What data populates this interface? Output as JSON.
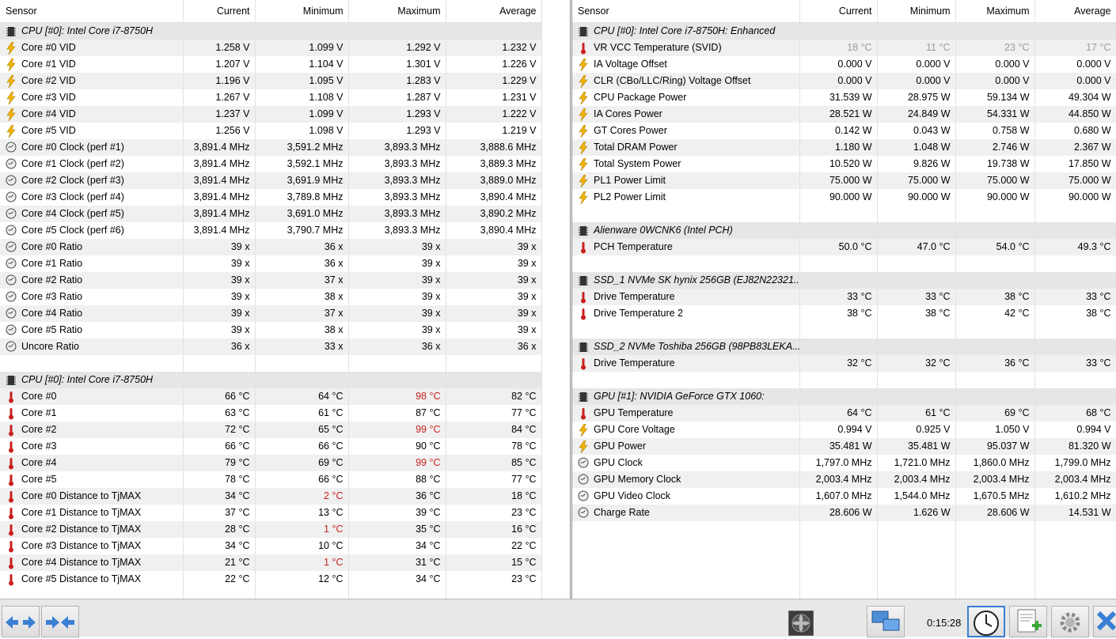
{
  "left": {
    "headers": [
      "Sensor",
      "Current",
      "Minimum",
      "Maximum",
      "Average"
    ],
    "rows": [
      {
        "type": "group",
        "icon": "chip",
        "name": "CPU [#0]: Intel Core i7-8750H"
      },
      {
        "icon": "bolt",
        "name": "Core #0 VID",
        "cur": "1.258 V",
        "min": "1.099 V",
        "max": "1.292 V",
        "avg": "1.232 V"
      },
      {
        "icon": "bolt",
        "name": "Core #1 VID",
        "cur": "1.207 V",
        "min": "1.104 V",
        "max": "1.301 V",
        "avg": "1.226 V"
      },
      {
        "icon": "bolt",
        "name": "Core #2 VID",
        "cur": "1.196 V",
        "min": "1.095 V",
        "max": "1.283 V",
        "avg": "1.229 V"
      },
      {
        "icon": "bolt",
        "name": "Core #3 VID",
        "cur": "1.267 V",
        "min": "1.108 V",
        "max": "1.287 V",
        "avg": "1.231 V"
      },
      {
        "icon": "bolt",
        "name": "Core #4 VID",
        "cur": "1.237 V",
        "min": "1.099 V",
        "max": "1.293 V",
        "avg": "1.222 V"
      },
      {
        "icon": "bolt",
        "name": "Core #5 VID",
        "cur": "1.256 V",
        "min": "1.098 V",
        "max": "1.293 V",
        "avg": "1.219 V"
      },
      {
        "icon": "clock",
        "name": "Core #0 Clock (perf #1)",
        "cur": "3,891.4 MHz",
        "min": "3,591.2 MHz",
        "max": "3,893.3 MHz",
        "avg": "3,888.6 MHz"
      },
      {
        "icon": "clock",
        "name": "Core #1 Clock (perf #2)",
        "cur": "3,891.4 MHz",
        "min": "3,592.1 MHz",
        "max": "3,893.3 MHz",
        "avg": "3,889.3 MHz"
      },
      {
        "icon": "clock",
        "name": "Core #2 Clock (perf #3)",
        "cur": "3,891.4 MHz",
        "min": "3,691.9 MHz",
        "max": "3,893.3 MHz",
        "avg": "3,889.0 MHz"
      },
      {
        "icon": "clock",
        "name": "Core #3 Clock (perf #4)",
        "cur": "3,891.4 MHz",
        "min": "3,789.8 MHz",
        "max": "3,893.3 MHz",
        "avg": "3,890.4 MHz"
      },
      {
        "icon": "clock",
        "name": "Core #4 Clock (perf #5)",
        "cur": "3,891.4 MHz",
        "min": "3,691.0 MHz",
        "max": "3,893.3 MHz",
        "avg": "3,890.2 MHz"
      },
      {
        "icon": "clock",
        "name": "Core #5 Clock (perf #6)",
        "cur": "3,891.4 MHz",
        "min": "3,790.7 MHz",
        "max": "3,893.3 MHz",
        "avg": "3,890.4 MHz"
      },
      {
        "icon": "clock",
        "name": "Core #0 Ratio",
        "cur": "39 x",
        "min": "36 x",
        "max": "39 x",
        "avg": "39 x"
      },
      {
        "icon": "clock",
        "name": "Core #1 Ratio",
        "cur": "39 x",
        "min": "36 x",
        "max": "39 x",
        "avg": "39 x"
      },
      {
        "icon": "clock",
        "name": "Core #2 Ratio",
        "cur": "39 x",
        "min": "37 x",
        "max": "39 x",
        "avg": "39 x"
      },
      {
        "icon": "clock",
        "name": "Core #3 Ratio",
        "cur": "39 x",
        "min": "38 x",
        "max": "39 x",
        "avg": "39 x"
      },
      {
        "icon": "clock",
        "name": "Core #4 Ratio",
        "cur": "39 x",
        "min": "37 x",
        "max": "39 x",
        "avg": "39 x"
      },
      {
        "icon": "clock",
        "name": "Core #5 Ratio",
        "cur": "39 x",
        "min": "38 x",
        "max": "39 x",
        "avg": "39 x"
      },
      {
        "icon": "clock",
        "name": "Uncore Ratio",
        "cur": "36 x",
        "min": "33 x",
        "max": "36 x",
        "avg": "36 x"
      },
      {
        "type": "blank"
      },
      {
        "type": "group",
        "icon": "chip",
        "name": "CPU [#0]: Intel Core i7-8750H"
      },
      {
        "icon": "therm",
        "name": "Core #0",
        "cur": "66 °C",
        "min": "64 °C",
        "max": "98 °C",
        "avg": "82 °C",
        "red": [
          "max"
        ]
      },
      {
        "icon": "therm",
        "name": "Core #1",
        "cur": "63 °C",
        "min": "61 °C",
        "max": "87 °C",
        "avg": "77 °C"
      },
      {
        "icon": "therm",
        "name": "Core #2",
        "cur": "72 °C",
        "min": "65 °C",
        "max": "99 °C",
        "avg": "84 °C",
        "red": [
          "max"
        ]
      },
      {
        "icon": "therm",
        "name": "Core #3",
        "cur": "66 °C",
        "min": "66 °C",
        "max": "90 °C",
        "avg": "78 °C"
      },
      {
        "icon": "therm",
        "name": "Core #4",
        "cur": "79 °C",
        "min": "69 °C",
        "max": "99 °C",
        "avg": "85 °C",
        "red": [
          "max"
        ]
      },
      {
        "icon": "therm",
        "name": "Core #5",
        "cur": "78 °C",
        "min": "66 °C",
        "max": "88 °C",
        "avg": "77 °C"
      },
      {
        "icon": "therm",
        "name": "Core #0 Distance to TjMAX",
        "cur": "34 °C",
        "min": "2 °C",
        "max": "36 °C",
        "avg": "18 °C",
        "red": [
          "min"
        ]
      },
      {
        "icon": "therm",
        "name": "Core #1 Distance to TjMAX",
        "cur": "37 °C",
        "min": "13 °C",
        "max": "39 °C",
        "avg": "23 °C"
      },
      {
        "icon": "therm",
        "name": "Core #2 Distance to TjMAX",
        "cur": "28 °C",
        "min": "1 °C",
        "max": "35 °C",
        "avg": "16 °C",
        "red": [
          "min"
        ]
      },
      {
        "icon": "therm",
        "name": "Core #3 Distance to TjMAX",
        "cur": "34 °C",
        "min": "10 °C",
        "max": "34 °C",
        "avg": "22 °C"
      },
      {
        "icon": "therm",
        "name": "Core #4 Distance to TjMAX",
        "cur": "21 °C",
        "min": "1 °C",
        "max": "31 °C",
        "avg": "15 °C",
        "red": [
          "min"
        ]
      },
      {
        "icon": "therm",
        "name": "Core #5 Distance to TjMAX",
        "cur": "22 °C",
        "min": "12 °C",
        "max": "34 °C",
        "avg": "23 °C"
      },
      {
        "type": "blank"
      }
    ]
  },
  "right": {
    "headers": [
      "Sensor",
      "Current",
      "Minimum",
      "Maximum",
      "Average"
    ],
    "rows": [
      {
        "type": "group",
        "icon": "chip",
        "name": "CPU [#0]: Intel Core i7-8750H: Enhanced"
      },
      {
        "icon": "therm",
        "name": "VR VCC Temperature (SVID)",
        "cur": "18 °C",
        "min": "11 °C",
        "max": "23 °C",
        "avg": "17 °C",
        "grey": true
      },
      {
        "icon": "bolt",
        "name": "IA Voltage Offset",
        "cur": "0.000 V",
        "min": "0.000 V",
        "max": "0.000 V",
        "avg": "0.000 V"
      },
      {
        "icon": "bolt",
        "name": "CLR (CBo/LLC/Ring) Voltage Offset",
        "cur": "0.000 V",
        "min": "0.000 V",
        "max": "0.000 V",
        "avg": "0.000 V"
      },
      {
        "icon": "bolt",
        "name": "CPU Package Power",
        "cur": "31.539 W",
        "min": "28.975 W",
        "max": "59.134 W",
        "avg": "49.304 W"
      },
      {
        "icon": "bolt",
        "name": "IA Cores Power",
        "cur": "28.521 W",
        "min": "24.849 W",
        "max": "54.331 W",
        "avg": "44.850 W"
      },
      {
        "icon": "bolt",
        "name": "GT Cores Power",
        "cur": "0.142 W",
        "min": "0.043 W",
        "max": "0.758 W",
        "avg": "0.680 W"
      },
      {
        "icon": "bolt",
        "name": "Total DRAM Power",
        "cur": "1.180 W",
        "min": "1.048 W",
        "max": "2.746 W",
        "avg": "2.367 W"
      },
      {
        "icon": "bolt",
        "name": "Total System Power",
        "cur": "10.520 W",
        "min": "9.826 W",
        "max": "19.738 W",
        "avg": "17.850 W"
      },
      {
        "icon": "bolt",
        "name": "PL1 Power Limit",
        "cur": "75.000 W",
        "min": "75.000 W",
        "max": "75.000 W",
        "avg": "75.000 W"
      },
      {
        "icon": "bolt",
        "name": "PL2 Power Limit",
        "cur": "90.000 W",
        "min": "90.000 W",
        "max": "90.000 W",
        "avg": "90.000 W"
      },
      {
        "type": "blank"
      },
      {
        "type": "group",
        "icon": "chip",
        "name": "Alienware 0WCNK6 (Intel PCH)"
      },
      {
        "icon": "therm",
        "name": "PCH Temperature",
        "cur": "50.0 °C",
        "min": "47.0 °C",
        "max": "54.0 °C",
        "avg": "49.3 °C"
      },
      {
        "type": "blank"
      },
      {
        "type": "group",
        "icon": "chip",
        "name": "SSD_1 NVMe SK hynix 256GB (EJ82N22321..."
      },
      {
        "icon": "therm",
        "name": "Drive Temperature",
        "cur": "33 °C",
        "min": "33 °C",
        "max": "38 °C",
        "avg": "33 °C"
      },
      {
        "icon": "therm",
        "name": "Drive Temperature 2",
        "cur": "38 °C",
        "min": "38 °C",
        "max": "42 °C",
        "avg": "38 °C"
      },
      {
        "type": "blank"
      },
      {
        "type": "group",
        "icon": "chip",
        "name": "SSD_2 NVMe Toshiba 256GB (98PB83LEKA..."
      },
      {
        "icon": "therm",
        "name": "Drive Temperature",
        "cur": "32 °C",
        "min": "32 °C",
        "max": "36 °C",
        "avg": "33 °C"
      },
      {
        "type": "blank"
      },
      {
        "type": "group",
        "icon": "chip",
        "name": "GPU [#1]: NVIDIA GeForce GTX 1060:"
      },
      {
        "icon": "therm",
        "name": "GPU Temperature",
        "cur": "64 °C",
        "min": "61 °C",
        "max": "69 °C",
        "avg": "68 °C"
      },
      {
        "icon": "bolt",
        "name": "GPU Core Voltage",
        "cur": "0.994 V",
        "min": "0.925 V",
        "max": "1.050 V",
        "avg": "0.994 V"
      },
      {
        "icon": "bolt",
        "name": "GPU Power",
        "cur": "35.481 W",
        "min": "35.481 W",
        "max": "95.037 W",
        "avg": "81.320 W"
      },
      {
        "icon": "clock",
        "name": "GPU Clock",
        "cur": "1,797.0 MHz",
        "min": "1,721.0 MHz",
        "max": "1,860.0 MHz",
        "avg": "1,799.0 MHz"
      },
      {
        "icon": "clock",
        "name": "GPU Memory Clock",
        "cur": "2,003.4 MHz",
        "min": "2,003.4 MHz",
        "max": "2,003.4 MHz",
        "avg": "2,003.4 MHz"
      },
      {
        "icon": "clock",
        "name": "GPU Video Clock",
        "cur": "1,607.0 MHz",
        "min": "1,544.0 MHz",
        "max": "1,670.5 MHz",
        "avg": "1,610.2 MHz"
      },
      {
        "icon": "clock",
        "name": "Charge Rate",
        "cur": "28.606 W",
        "min": "1.626 W",
        "max": "28.606 W",
        "avg": "14.531 W"
      },
      {
        "type": "blank"
      },
      {
        "type": "blank"
      },
      {
        "type": "blank"
      },
      {
        "type": "blank"
      },
      {
        "type": "blank"
      }
    ]
  },
  "toolbar": {
    "elapsed": "0:15:28",
    "buttons": [
      "nav-left-right-arrows-icon",
      "collapse-arrows-icon",
      "fan-icon",
      "network-icon",
      "clock-icon",
      "add-log-icon",
      "settings-gear-icon",
      "close-x-icon"
    ]
  },
  "colors": {
    "bolt": "#f2b400",
    "therm": "#c8201e",
    "chip": "#333333",
    "red_value": "#c81e1e",
    "grey_value": "#9a9a9a"
  }
}
